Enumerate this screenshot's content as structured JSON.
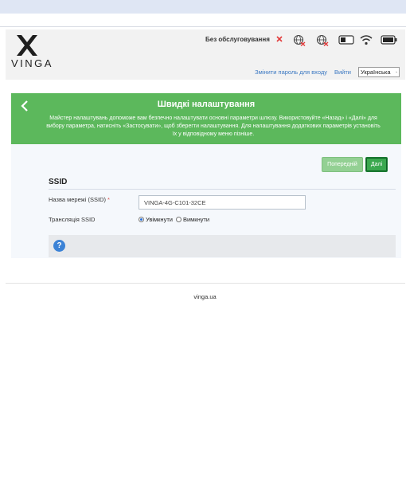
{
  "header": {
    "logo_text": "VINGA",
    "service_status": "Без обслуговування",
    "links": {
      "change_password": "Змінити пароль для входу",
      "logout": "Вийти"
    },
    "language": {
      "selected": "Українська"
    }
  },
  "status_icons": [
    "sim-error-icon",
    "network-off-icon",
    "internet-off-icon",
    "sd-card-icon",
    "wifi-icon",
    "battery-icon"
  ],
  "wizard": {
    "title": "Швидкі налаштування",
    "description": "Майстер налаштувань допоможе вам безпечно налаштувати основні параметри шлюзу. Використовуйте «Назад» і «Далі» для вибору параметра, натисніть «Застосувати», щоб зберегти налаштування. Для налаштування додаткових параметрів установіть їх у відповідному меню пізніше.",
    "buttons": {
      "previous": "Попередній",
      "next": "Далі"
    }
  },
  "ssid_section": {
    "title": "SSID",
    "network_name_label": "Назва мережі (SSID)",
    "required_mark": "*",
    "network_name_value": "VINGA-4G-C101-32CE",
    "broadcast_label": "Трансляція SSID",
    "broadcast_options": {
      "on": "Увімкнути",
      "off": "Вимкнути"
    },
    "broadcast_selected": "on"
  },
  "footer": {
    "text": "vinga.ua"
  },
  "colors": {
    "banner_green": "#5cb85c",
    "next_button": "#3aa84e",
    "link_blue": "#3b78c2",
    "error_red": "#e23b3b"
  }
}
